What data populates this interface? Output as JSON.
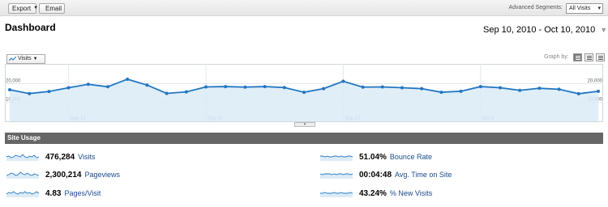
{
  "toolbar": {
    "export_label": "Export",
    "email_label": "Email",
    "advanced_segments_label": "Advanced Segments:",
    "segment_value": "All Visits"
  },
  "dashboard": {
    "title": "Dashboard",
    "date_range": "Sep 10, 2010 - Oct 10, 2010"
  },
  "graph": {
    "metric": "Visits",
    "graph_by_label": "Graph by:",
    "selected_granularity": "day"
  },
  "chart_data": {
    "type": "line",
    "y_ticks": [
      "20,000",
      "10,000"
    ],
    "ylim": [
      0,
      30000
    ],
    "x_ticks": [
      "Sep 13",
      "Sep 20",
      "Sep 27",
      "Oct 4"
    ],
    "x_tick_day_index": [
      3,
      10,
      17,
      24
    ],
    "series": [
      {
        "values": [
          16700,
          14700,
          15800,
          17800,
          19600,
          18300,
          22300,
          19200,
          14800,
          15600,
          18200,
          18400,
          18100,
          18400,
          17900,
          15400,
          17300,
          21200,
          18100,
          18200,
          17800,
          17300,
          15400,
          15900,
          18400,
          17800,
          16400,
          17500,
          17000,
          14600,
          15900
        ]
      }
    ],
    "colors": {
      "line": "#2276c2",
      "fill": "#dbebf7",
      "grid": "#d0d7de",
      "tick_text": "#4a7ab0"
    },
    "grid": true
  },
  "site_usage": {
    "heading": "Site Usage",
    "left": [
      {
        "value": "476,284",
        "label": "Visits"
      },
      {
        "value": "2,300,214",
        "label": "Pageviews"
      },
      {
        "value": "4.83",
        "label": "Pages/Visit"
      }
    ],
    "right": [
      {
        "value": "51.04%",
        "label": "Bounce Rate"
      },
      {
        "value": "00:04:48",
        "label": "Avg. Time on Site"
      },
      {
        "value": "43.24%",
        "label": "% New Visits"
      }
    ]
  }
}
